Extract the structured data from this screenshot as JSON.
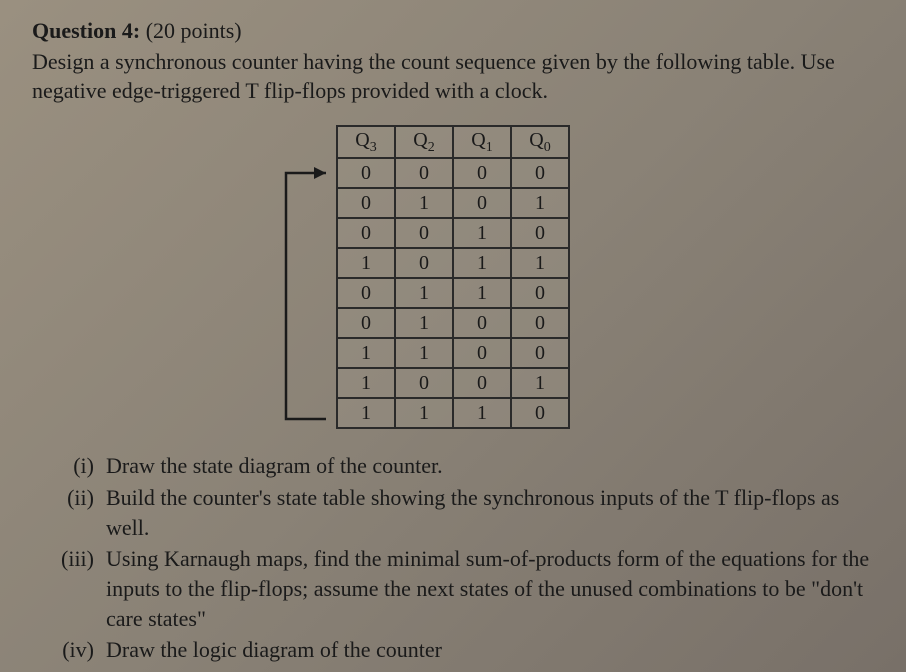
{
  "question": {
    "label": "Question 4:",
    "points": "(20 points)",
    "prompt": "Design a synchronous counter having the count sequence given by the following table. Use negative edge-triggered T flip-flops provided with a clock."
  },
  "table": {
    "headers": [
      {
        "base": "Q",
        "sub": "3"
      },
      {
        "base": "Q",
        "sub": "2"
      },
      {
        "base": "Q",
        "sub": "1"
      },
      {
        "base": "Q",
        "sub": "0"
      }
    ],
    "rows": [
      [
        "0",
        "0",
        "0",
        "0"
      ],
      [
        "0",
        "1",
        "0",
        "1"
      ],
      [
        "0",
        "0",
        "1",
        "0"
      ],
      [
        "1",
        "0",
        "1",
        "1"
      ],
      [
        "0",
        "1",
        "1",
        "0"
      ],
      [
        "0",
        "1",
        "0",
        "0"
      ],
      [
        "1",
        "1",
        "0",
        "0"
      ],
      [
        "1",
        "0",
        "0",
        "1"
      ],
      [
        "1",
        "1",
        "1",
        "0"
      ]
    ]
  },
  "subparts": [
    {
      "label": "(i)",
      "text": "Draw the state diagram of the counter."
    },
    {
      "label": "(ii)",
      "text": "Build the counter's state table showing the synchronous inputs of the T flip-flops as well."
    },
    {
      "label": "(iii)",
      "text": "Using Karnaugh maps, find the minimal sum-of-products form of the equations for the inputs to the flip-flops; assume the next states of the unused combinations to be \"don't care states\""
    },
    {
      "label": "(iv)",
      "text": "Draw the logic diagram of the counter"
    }
  ]
}
